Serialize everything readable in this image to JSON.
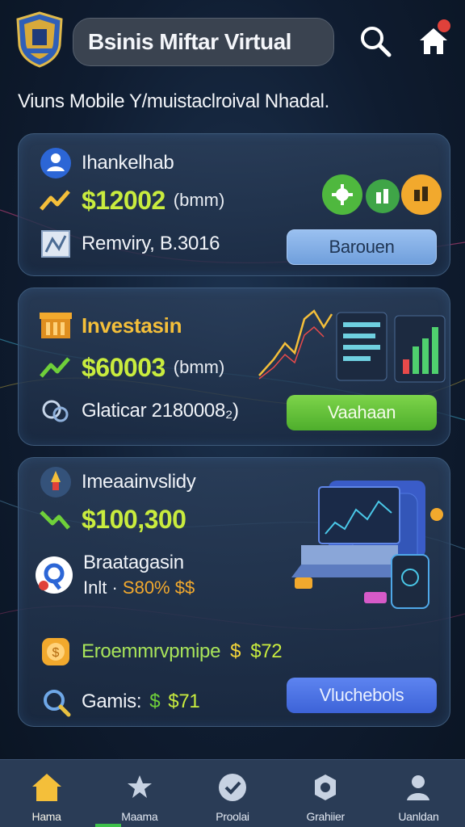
{
  "header": {
    "title": "Bsinis Miftar Virtual",
    "subtitle": "Viuns Mobile Y/muistaclroival Nhadal."
  },
  "cards": [
    {
      "heading": "Ihankelhab",
      "amount": "$12002",
      "amount_note": "(bmm)",
      "detail": "Remviry, B.3016",
      "button": "Barouen"
    },
    {
      "heading": "Investasin",
      "amount": "$60003",
      "amount_note": "(bmm)",
      "detail": "Glaticar 2180008₂)",
      "button": "Vaahaan"
    },
    {
      "heading": "Imeaainvslidy",
      "amount": "$100,300",
      "sub_heading": "Braatagasin",
      "sub_line_a": "Inlt · ",
      "sub_line_b": "S80% $$",
      "reward_label": "Eroemmrvpmipe",
      "reward_symbol": "$",
      "reward_value": "$72",
      "games_label": "Gamis:",
      "games_symbol": "$",
      "games_value": "$71",
      "button": "Vluchebols"
    }
  ],
  "nav": [
    {
      "label": "Hama",
      "icon": "home-icon"
    },
    {
      "label": "Maama",
      "icon": "star-icon"
    },
    {
      "label": "Proolai",
      "icon": "check-icon"
    },
    {
      "label": "Grahiier",
      "icon": "gear-icon"
    },
    {
      "label": "Uanldan",
      "icon": "user-icon"
    }
  ],
  "colors": {
    "accent_green": "#c9ec3e",
    "accent_gold": "#f4bf3a",
    "button_blue": "#6f9fdc",
    "button_green": "#4eae2c",
    "button_vivid": "#3d63d8",
    "nav_background": "#2a3c56"
  }
}
